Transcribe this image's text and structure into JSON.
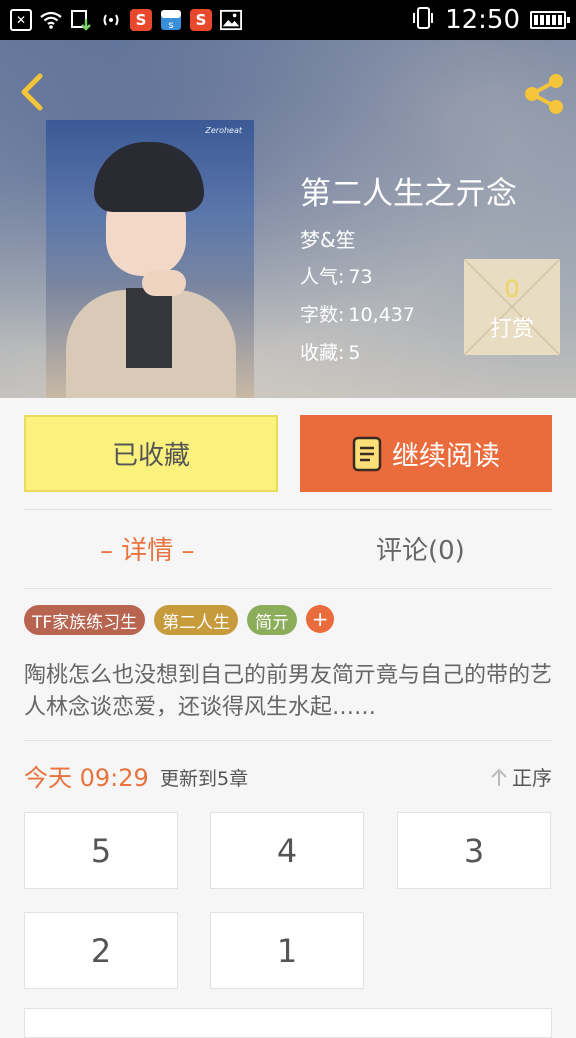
{
  "status_bar": {
    "time": "12:50",
    "icons": [
      "close-box-icon",
      "wifi-icon",
      "download-icon",
      "hotspot-icon",
      "sogou-icon",
      "app-s-icon",
      "sogou-icon-2",
      "image-icon"
    ],
    "right_icons": [
      "phone-vibrate-icon",
      "battery-icon"
    ]
  },
  "header": {
    "back_icon": "chevron-left-icon",
    "share_icon": "share-icon"
  },
  "book": {
    "title": "第二人生之亓念",
    "author": "梦&笙",
    "popularity_label": "人气:",
    "popularity": "73",
    "words_label": "字数:",
    "words": "10,437",
    "favorites_label": "收藏:",
    "favorites": "5",
    "cover_caption": "Zeroheat"
  },
  "reward": {
    "count": "0",
    "label": "打赏"
  },
  "actions": {
    "favorite_label": "已收藏",
    "read_label": "继续阅读"
  },
  "tabs": {
    "detail": "– 详情 –",
    "comments": "评论(0)"
  },
  "tags": [
    "TF家族练习生",
    "第二人生",
    "简亓"
  ],
  "tag_add": "+",
  "synopsis": "陶桃怎么也没想到自己的前男友简亓竟与自己的带的艺人林念谈恋爱，还谈得风生水起……",
  "updates": {
    "time": "今天 09:29",
    "text": "更新到5章",
    "sort_label": "正序"
  },
  "chapters": [
    "5",
    "4",
    "3",
    "2",
    "1"
  ],
  "colors": {
    "accent": "#ea6b3b",
    "favorite_bg": "#fbf27e",
    "tag_1": "#b76550",
    "tag_2": "#c79a3c",
    "tag_3": "#8cae5a"
  }
}
